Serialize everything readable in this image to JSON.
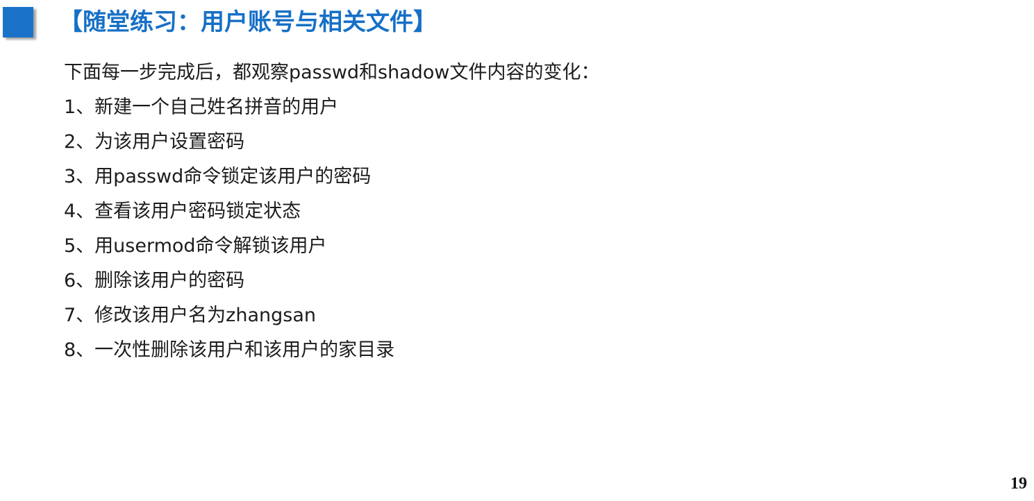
{
  "slide": {
    "title": "【随堂练习：用户账号与相关文件】",
    "intro": "下面每一步完成后，都观察passwd和shadow文件内容的变化：",
    "steps": [
      "1、新建一个自己姓名拼音的用户",
      "2、为该用户设置密码",
      "3、用passwd命令锁定该用户的密码",
      "4、查看该用户密码锁定状态",
      "5、用usermod命令解锁该用户",
      "6、删除该用户的密码",
      "7、修改该用户名为zhangsan",
      "8、一次性删除该用户和该用户的家目录"
    ],
    "page_number": "19"
  },
  "colors": {
    "accent": "#1670c6",
    "marker": "#1a73c8",
    "text": "#1c1c1c"
  }
}
